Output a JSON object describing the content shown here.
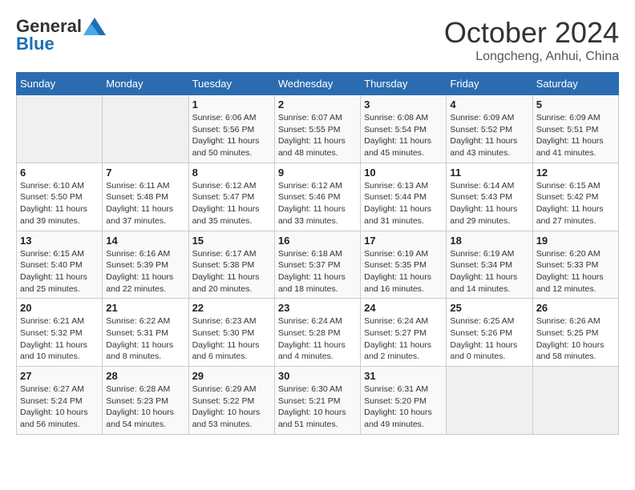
{
  "header": {
    "logo_general": "General",
    "logo_blue": "Blue",
    "month": "October 2024",
    "location": "Longcheng, Anhui, China"
  },
  "columns": [
    "Sunday",
    "Monday",
    "Tuesday",
    "Wednesday",
    "Thursday",
    "Friday",
    "Saturday"
  ],
  "weeks": [
    [
      {
        "day": "",
        "sunrise": "",
        "sunset": "",
        "daylight": ""
      },
      {
        "day": "",
        "sunrise": "",
        "sunset": "",
        "daylight": ""
      },
      {
        "day": "1",
        "sunrise": "Sunrise: 6:06 AM",
        "sunset": "Sunset: 5:56 PM",
        "daylight": "Daylight: 11 hours and 50 minutes."
      },
      {
        "day": "2",
        "sunrise": "Sunrise: 6:07 AM",
        "sunset": "Sunset: 5:55 PM",
        "daylight": "Daylight: 11 hours and 48 minutes."
      },
      {
        "day": "3",
        "sunrise": "Sunrise: 6:08 AM",
        "sunset": "Sunset: 5:54 PM",
        "daylight": "Daylight: 11 hours and 45 minutes."
      },
      {
        "day": "4",
        "sunrise": "Sunrise: 6:09 AM",
        "sunset": "Sunset: 5:52 PM",
        "daylight": "Daylight: 11 hours and 43 minutes."
      },
      {
        "day": "5",
        "sunrise": "Sunrise: 6:09 AM",
        "sunset": "Sunset: 5:51 PM",
        "daylight": "Daylight: 11 hours and 41 minutes."
      }
    ],
    [
      {
        "day": "6",
        "sunrise": "Sunrise: 6:10 AM",
        "sunset": "Sunset: 5:50 PM",
        "daylight": "Daylight: 11 hours and 39 minutes."
      },
      {
        "day": "7",
        "sunrise": "Sunrise: 6:11 AM",
        "sunset": "Sunset: 5:48 PM",
        "daylight": "Daylight: 11 hours and 37 minutes."
      },
      {
        "day": "8",
        "sunrise": "Sunrise: 6:12 AM",
        "sunset": "Sunset: 5:47 PM",
        "daylight": "Daylight: 11 hours and 35 minutes."
      },
      {
        "day": "9",
        "sunrise": "Sunrise: 6:12 AM",
        "sunset": "Sunset: 5:46 PM",
        "daylight": "Daylight: 11 hours and 33 minutes."
      },
      {
        "day": "10",
        "sunrise": "Sunrise: 6:13 AM",
        "sunset": "Sunset: 5:44 PM",
        "daylight": "Daylight: 11 hours and 31 minutes."
      },
      {
        "day": "11",
        "sunrise": "Sunrise: 6:14 AM",
        "sunset": "Sunset: 5:43 PM",
        "daylight": "Daylight: 11 hours and 29 minutes."
      },
      {
        "day": "12",
        "sunrise": "Sunrise: 6:15 AM",
        "sunset": "Sunset: 5:42 PM",
        "daylight": "Daylight: 11 hours and 27 minutes."
      }
    ],
    [
      {
        "day": "13",
        "sunrise": "Sunrise: 6:15 AM",
        "sunset": "Sunset: 5:40 PM",
        "daylight": "Daylight: 11 hours and 25 minutes."
      },
      {
        "day": "14",
        "sunrise": "Sunrise: 6:16 AM",
        "sunset": "Sunset: 5:39 PM",
        "daylight": "Daylight: 11 hours and 22 minutes."
      },
      {
        "day": "15",
        "sunrise": "Sunrise: 6:17 AM",
        "sunset": "Sunset: 5:38 PM",
        "daylight": "Daylight: 11 hours and 20 minutes."
      },
      {
        "day": "16",
        "sunrise": "Sunrise: 6:18 AM",
        "sunset": "Sunset: 5:37 PM",
        "daylight": "Daylight: 11 hours and 18 minutes."
      },
      {
        "day": "17",
        "sunrise": "Sunrise: 6:19 AM",
        "sunset": "Sunset: 5:35 PM",
        "daylight": "Daylight: 11 hours and 16 minutes."
      },
      {
        "day": "18",
        "sunrise": "Sunrise: 6:19 AM",
        "sunset": "Sunset: 5:34 PM",
        "daylight": "Daylight: 11 hours and 14 minutes."
      },
      {
        "day": "19",
        "sunrise": "Sunrise: 6:20 AM",
        "sunset": "Sunset: 5:33 PM",
        "daylight": "Daylight: 11 hours and 12 minutes."
      }
    ],
    [
      {
        "day": "20",
        "sunrise": "Sunrise: 6:21 AM",
        "sunset": "Sunset: 5:32 PM",
        "daylight": "Daylight: 11 hours and 10 minutes."
      },
      {
        "day": "21",
        "sunrise": "Sunrise: 6:22 AM",
        "sunset": "Sunset: 5:31 PM",
        "daylight": "Daylight: 11 hours and 8 minutes."
      },
      {
        "day": "22",
        "sunrise": "Sunrise: 6:23 AM",
        "sunset": "Sunset: 5:30 PM",
        "daylight": "Daylight: 11 hours and 6 minutes."
      },
      {
        "day": "23",
        "sunrise": "Sunrise: 6:24 AM",
        "sunset": "Sunset: 5:28 PM",
        "daylight": "Daylight: 11 hours and 4 minutes."
      },
      {
        "day": "24",
        "sunrise": "Sunrise: 6:24 AM",
        "sunset": "Sunset: 5:27 PM",
        "daylight": "Daylight: 11 hours and 2 minutes."
      },
      {
        "day": "25",
        "sunrise": "Sunrise: 6:25 AM",
        "sunset": "Sunset: 5:26 PM",
        "daylight": "Daylight: 11 hours and 0 minutes."
      },
      {
        "day": "26",
        "sunrise": "Sunrise: 6:26 AM",
        "sunset": "Sunset: 5:25 PM",
        "daylight": "Daylight: 10 hours and 58 minutes."
      }
    ],
    [
      {
        "day": "27",
        "sunrise": "Sunrise: 6:27 AM",
        "sunset": "Sunset: 5:24 PM",
        "daylight": "Daylight: 10 hours and 56 minutes."
      },
      {
        "day": "28",
        "sunrise": "Sunrise: 6:28 AM",
        "sunset": "Sunset: 5:23 PM",
        "daylight": "Daylight: 10 hours and 54 minutes."
      },
      {
        "day": "29",
        "sunrise": "Sunrise: 6:29 AM",
        "sunset": "Sunset: 5:22 PM",
        "daylight": "Daylight: 10 hours and 53 minutes."
      },
      {
        "day": "30",
        "sunrise": "Sunrise: 6:30 AM",
        "sunset": "Sunset: 5:21 PM",
        "daylight": "Daylight: 10 hours and 51 minutes."
      },
      {
        "day": "31",
        "sunrise": "Sunrise: 6:31 AM",
        "sunset": "Sunset: 5:20 PM",
        "daylight": "Daylight: 10 hours and 49 minutes."
      },
      {
        "day": "",
        "sunrise": "",
        "sunset": "",
        "daylight": ""
      },
      {
        "day": "",
        "sunrise": "",
        "sunset": "",
        "daylight": ""
      }
    ]
  ]
}
